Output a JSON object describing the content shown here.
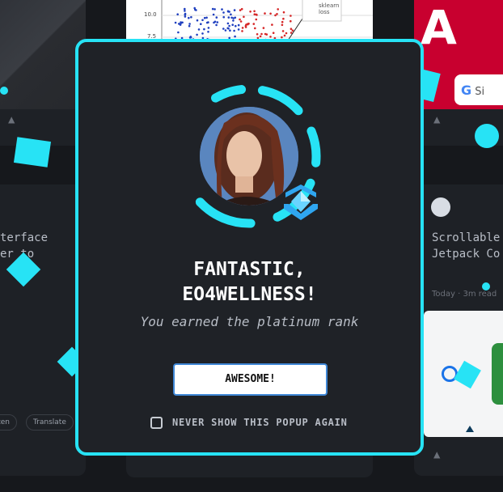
{
  "background": {
    "card_left2_text": "terface\ner to",
    "card_right2_text": "Scrollable\nJetpack Co",
    "card_right2_meta": "Today · 3m read",
    "chips": [
      "Listen",
      "Translate"
    ],
    "google_label": "Si",
    "chart_ticks": [
      "10.0",
      "7.5"
    ],
    "chart_legend": "sklearn\nloss"
  },
  "modal": {
    "title_line1": "FANTASTIC,",
    "title_line2": "EO4WELLNESS!",
    "subtitle": "You earned the platinum rank",
    "button_label": "AWESOME!",
    "checkbox_label": "NEVER SHOW THIS POPUP AGAIN",
    "checkbox_checked": false
  },
  "colors": {
    "accent": "#27e3f5",
    "modal_bg": "#1f2227",
    "button_border": "#3f87d6"
  },
  "icons": {
    "rank_badge": "platinum-rank-icon",
    "confetti": "confetti-shape"
  }
}
